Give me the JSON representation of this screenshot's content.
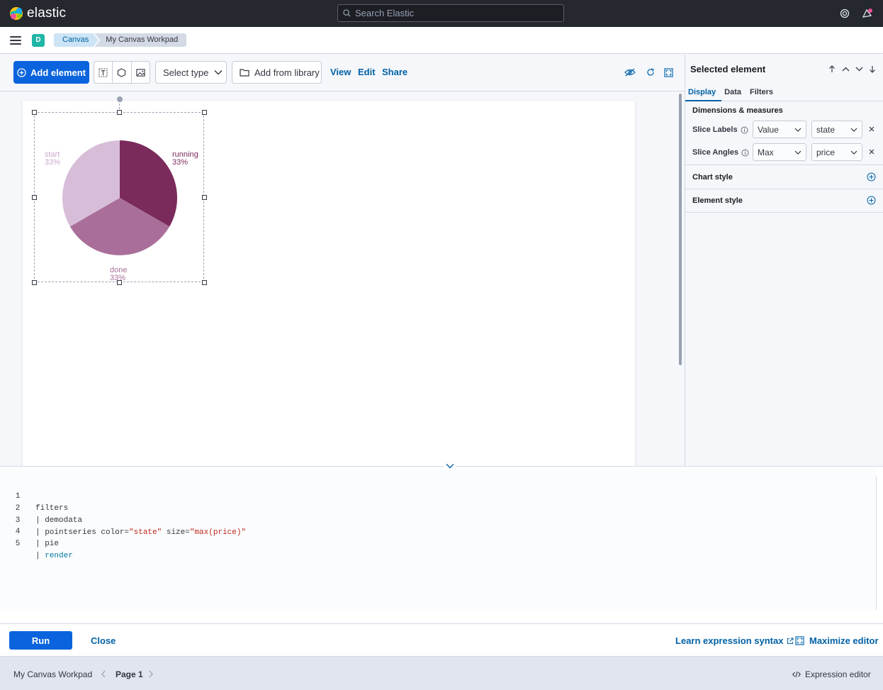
{
  "header": {
    "brand": "elastic",
    "search_placeholder": "Search Elastic",
    "icons": [
      "help-icon",
      "newsfeed-icon"
    ]
  },
  "breadcrumbs": {
    "space_initial": "D",
    "items": [
      "Canvas",
      "My Canvas Workpad"
    ]
  },
  "toolbar": {
    "add_element": "Add element",
    "select_type": "Select type",
    "add_from_library": "Add from library",
    "view": "View",
    "edit": "Edit",
    "share": "Share",
    "tool_icons": [
      "text-icon",
      "shape-icon",
      "image-icon"
    ],
    "right_icons": [
      "hide-editing-controls-icon",
      "refresh-icon",
      "fullscreen-icon"
    ]
  },
  "canvas": {
    "element": {
      "type": "pie",
      "slices": [
        {
          "label": "running",
          "percent": "33%",
          "color": "#7b2a5c"
        },
        {
          "label": "done",
          "percent": "33%",
          "color": "#a96f9a"
        },
        {
          "label": "start",
          "percent": "33%",
          "color": "#d7bdd8"
        }
      ]
    }
  },
  "sidebar": {
    "title": "Selected element",
    "tabs": [
      "Display",
      "Data",
      "Filters"
    ],
    "active_tab": "Display",
    "section_title": "Dimensions & measures",
    "rows": [
      {
        "label": "Slice Labels",
        "fn": "Value",
        "field": "state"
      },
      {
        "label": "Slice Angles",
        "fn": "Max",
        "field": "price"
      }
    ],
    "accordions": [
      "Chart style",
      "Element style"
    ]
  },
  "editor": {
    "lines": [
      {
        "num": "1",
        "text": "filters"
      },
      {
        "num": "2",
        "text": "| demodata"
      },
      {
        "num": "3",
        "pre": "| pointseries color=",
        "s1": "\"state\"",
        "mid": " size=",
        "s2": "\"max(price)\""
      },
      {
        "num": "4",
        "text": "| pie"
      },
      {
        "num": "5",
        "pipe": "| ",
        "kw": "render"
      }
    ],
    "run": "Run",
    "close": "Close",
    "learn": "Learn expression syntax",
    "maximize": "Maximize editor"
  },
  "pagebar": {
    "workpad_name": "My Canvas Workpad",
    "page_label": "Page 1",
    "expression_editor": "Expression editor"
  },
  "colors": {
    "accent": "#0b64dd",
    "link": "#0061a6",
    "header_bg": "#25282f"
  }
}
